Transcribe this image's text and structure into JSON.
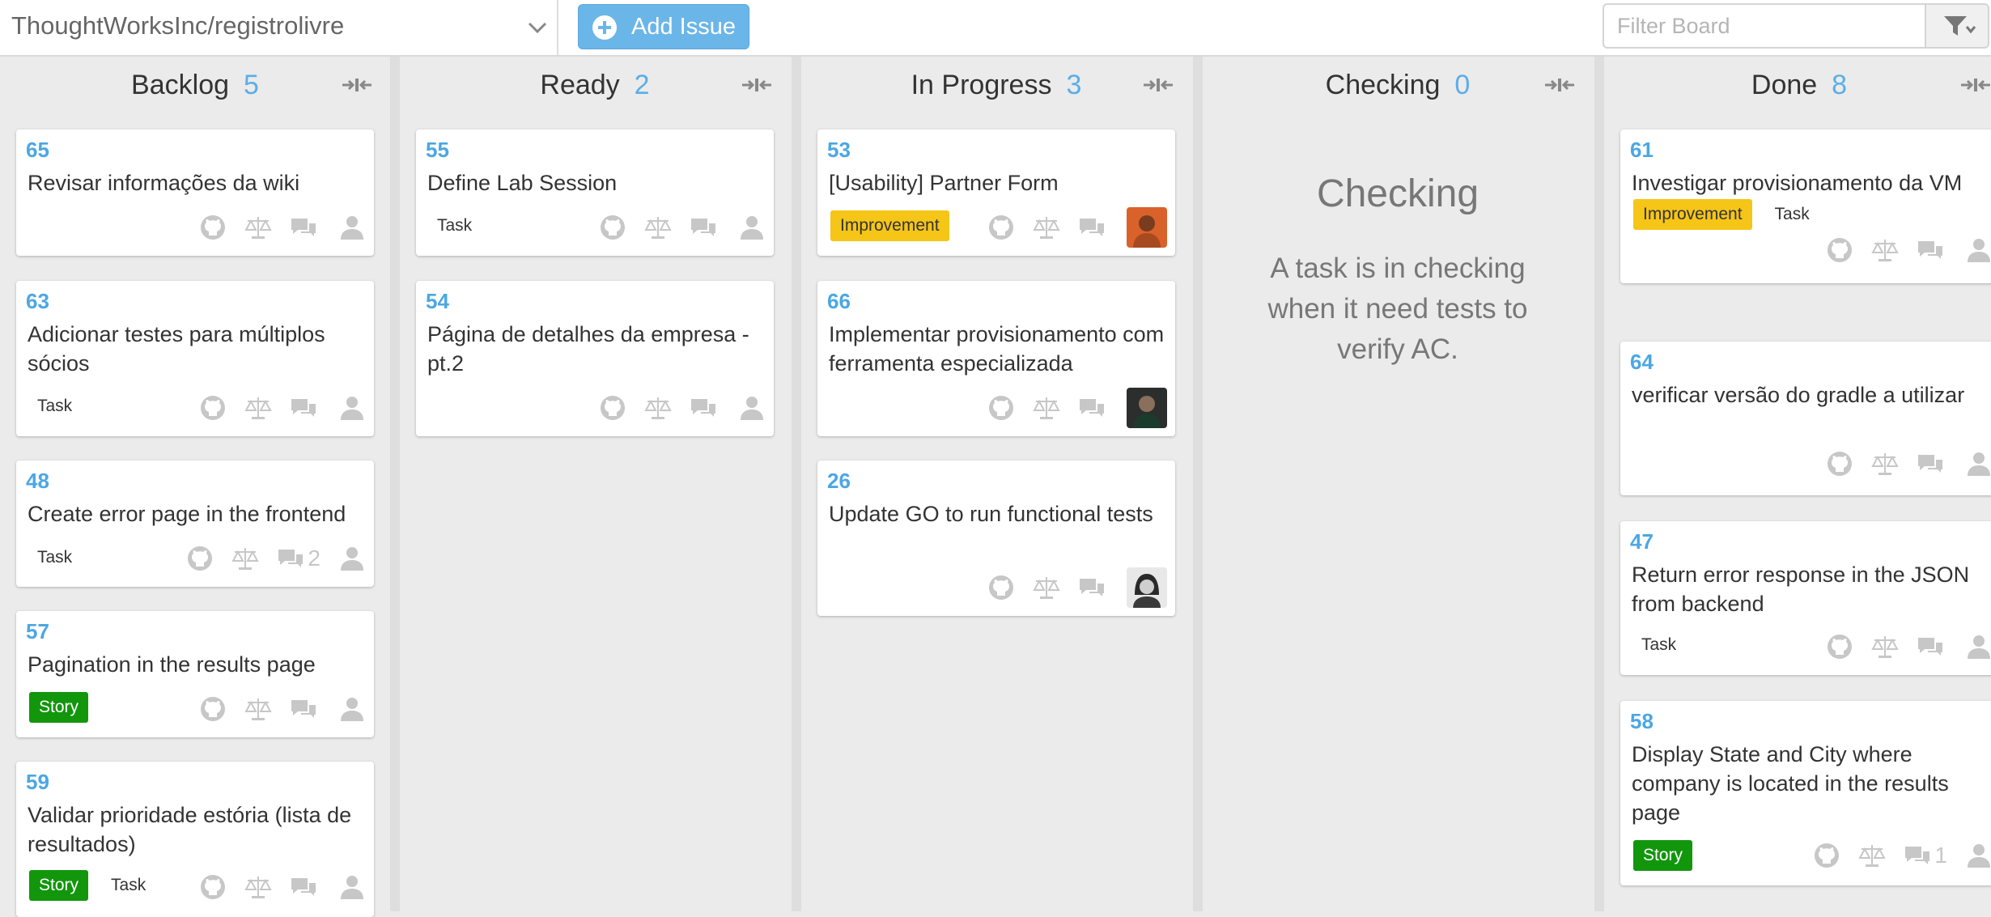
{
  "toolbar": {
    "repo": "ThoughtWorksInc/registrolivre",
    "add_issue": "Add Issue",
    "filter_placeholder": "Filter Board"
  },
  "columns": [
    {
      "name": "Backlog",
      "count": "5",
      "cards": [
        {
          "num": "65",
          "title": "Revisar informações da wiki",
          "labels": [],
          "comments": ""
        },
        {
          "num": "63",
          "title": "Adicionar testes para múltiplos sócios",
          "labels": [
            "Task"
          ],
          "comments": ""
        },
        {
          "num": "48",
          "title": "Create error page in the frontend",
          "labels": [
            "Task"
          ],
          "comments": "2"
        },
        {
          "num": "57",
          "title": "Pagination in the results page",
          "labels": [
            "Story"
          ],
          "comments": ""
        },
        {
          "num": "59",
          "title": "Validar prioridade estória (lista de resultados)",
          "labels": [
            "Story",
            "Task"
          ],
          "comments": ""
        }
      ]
    },
    {
      "name": "Ready",
      "count": "2",
      "cards": [
        {
          "num": "55",
          "title": "Define Lab Session",
          "labels": [
            "Task"
          ],
          "comments": ""
        },
        {
          "num": "54",
          "title": "Página de detalhes da empresa - pt.2",
          "labels": [],
          "comments": ""
        }
      ]
    },
    {
      "name": "In Progress",
      "count": "3",
      "cards": [
        {
          "num": "53",
          "title": "[Usability] Partner Form",
          "labels": [
            "Improvement"
          ],
          "comments": "",
          "avatar": "orange-avatar"
        },
        {
          "num": "66",
          "title": "Implementar provisionamento com ferramenta especializada",
          "labels": [],
          "comments": "",
          "avatar": "dark-avatar"
        },
        {
          "num": "26",
          "title": "Update GO to run functional tests",
          "labels": [],
          "comments": "",
          "avatar": "gray-avatar"
        }
      ]
    },
    {
      "name": "Checking",
      "count": "0",
      "empty_title": "Checking",
      "empty_desc": "A task is in checking when it need tests to verify AC.",
      "cards": []
    },
    {
      "name": "Done",
      "count": "8",
      "cards": [
        {
          "num": "61",
          "title": "Investigar provisionamento da VM",
          "labels": [
            "Improvement",
            "Task"
          ],
          "comments": ""
        },
        {
          "num": "64",
          "title": "verificar versão do gradle a utilizar",
          "labels": [],
          "comments": ""
        },
        {
          "num": "47",
          "title": "Return error response in the JSON from backend",
          "labels": [
            "Task"
          ],
          "comments": ""
        },
        {
          "num": "58",
          "title": "Display State and City where company is located in the results page",
          "labels": [
            "Story"
          ],
          "comments": "1"
        }
      ]
    }
  ],
  "colors": {
    "accent": "#4ba7e4",
    "story": "#12960c",
    "improvement": "#f5c518",
    "icon": "#c7c7c7"
  },
  "icons": [
    "chevron-down-icon",
    "plus-circle-icon",
    "filter-icon",
    "collapse-icon",
    "github-icon",
    "scales-icon",
    "comments-icon",
    "user-icon"
  ]
}
